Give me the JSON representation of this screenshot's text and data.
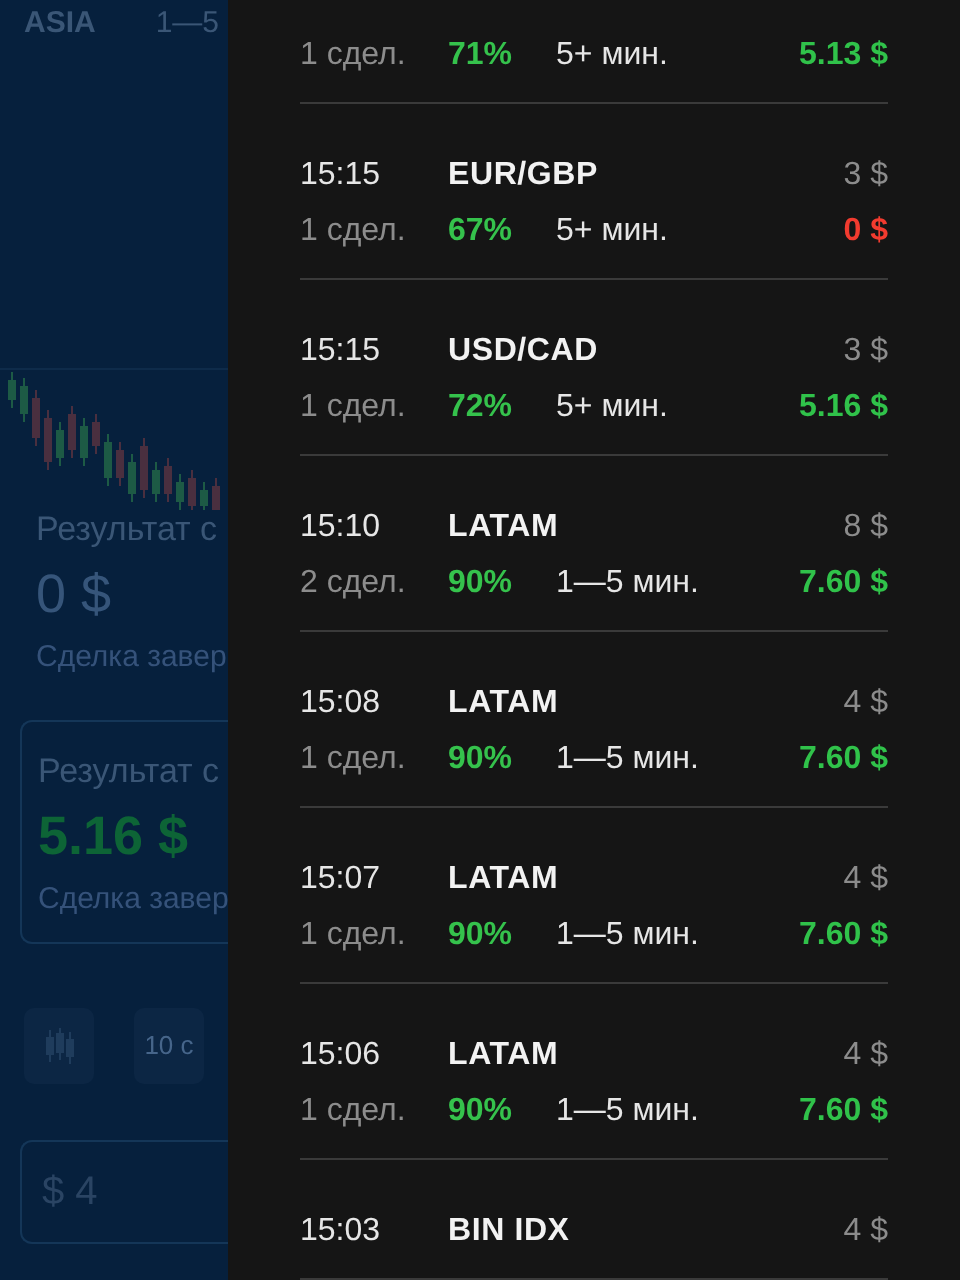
{
  "background": {
    "asset": "ASIA",
    "duration": "1—5",
    "results": [
      {
        "kind": "plain",
        "title": "Результат с",
        "amount": "0 $",
        "note": "Сделка завер"
      },
      {
        "kind": "card",
        "title": "Результат с",
        "amount": "5.16 $",
        "note": "Сделка завер"
      }
    ],
    "timeframe": "10 с",
    "amount_field": {
      "value": "$ 4"
    }
  },
  "trades": [
    {
      "count": "1 сдел.",
      "percent": "71%",
      "duration": "5+ мин.",
      "result": "5.13 $",
      "kind": "profit"
    },
    {
      "time": "15:15",
      "pair": "EUR/GBP",
      "stake": "3 $",
      "count": "1 сдел.",
      "percent": "67%",
      "duration": "5+ мин.",
      "result": "0 $",
      "kind": "loss"
    },
    {
      "time": "15:15",
      "pair": "USD/CAD",
      "stake": "3 $",
      "count": "1 сдел.",
      "percent": "72%",
      "duration": "5+ мин.",
      "result": "5.16 $",
      "kind": "profit"
    },
    {
      "time": "15:10",
      "pair": "LATAM",
      "stake": "8 $",
      "count": "2 сдел.",
      "percent": "90%",
      "duration": "1—5 мин.",
      "result": "7.60 $",
      "kind": "profit"
    },
    {
      "time": "15:08",
      "pair": "LATAM",
      "stake": "4 $",
      "count": "1 сдел.",
      "percent": "90%",
      "duration": "1—5 мин.",
      "result": "7.60 $",
      "kind": "profit"
    },
    {
      "time": "15:07",
      "pair": "LATAM",
      "stake": "4 $",
      "count": "1 сдел.",
      "percent": "90%",
      "duration": "1—5 мин.",
      "result": "7.60 $",
      "kind": "profit"
    },
    {
      "time": "15:06",
      "pair": "LATAM",
      "stake": "4 $",
      "count": "1 сдел.",
      "percent": "90%",
      "duration": "1—5 мин.",
      "result": "7.60 $",
      "kind": "profit"
    },
    {
      "time": "15:03",
      "pair": "BIN IDX",
      "stake": "4 $"
    }
  ]
}
